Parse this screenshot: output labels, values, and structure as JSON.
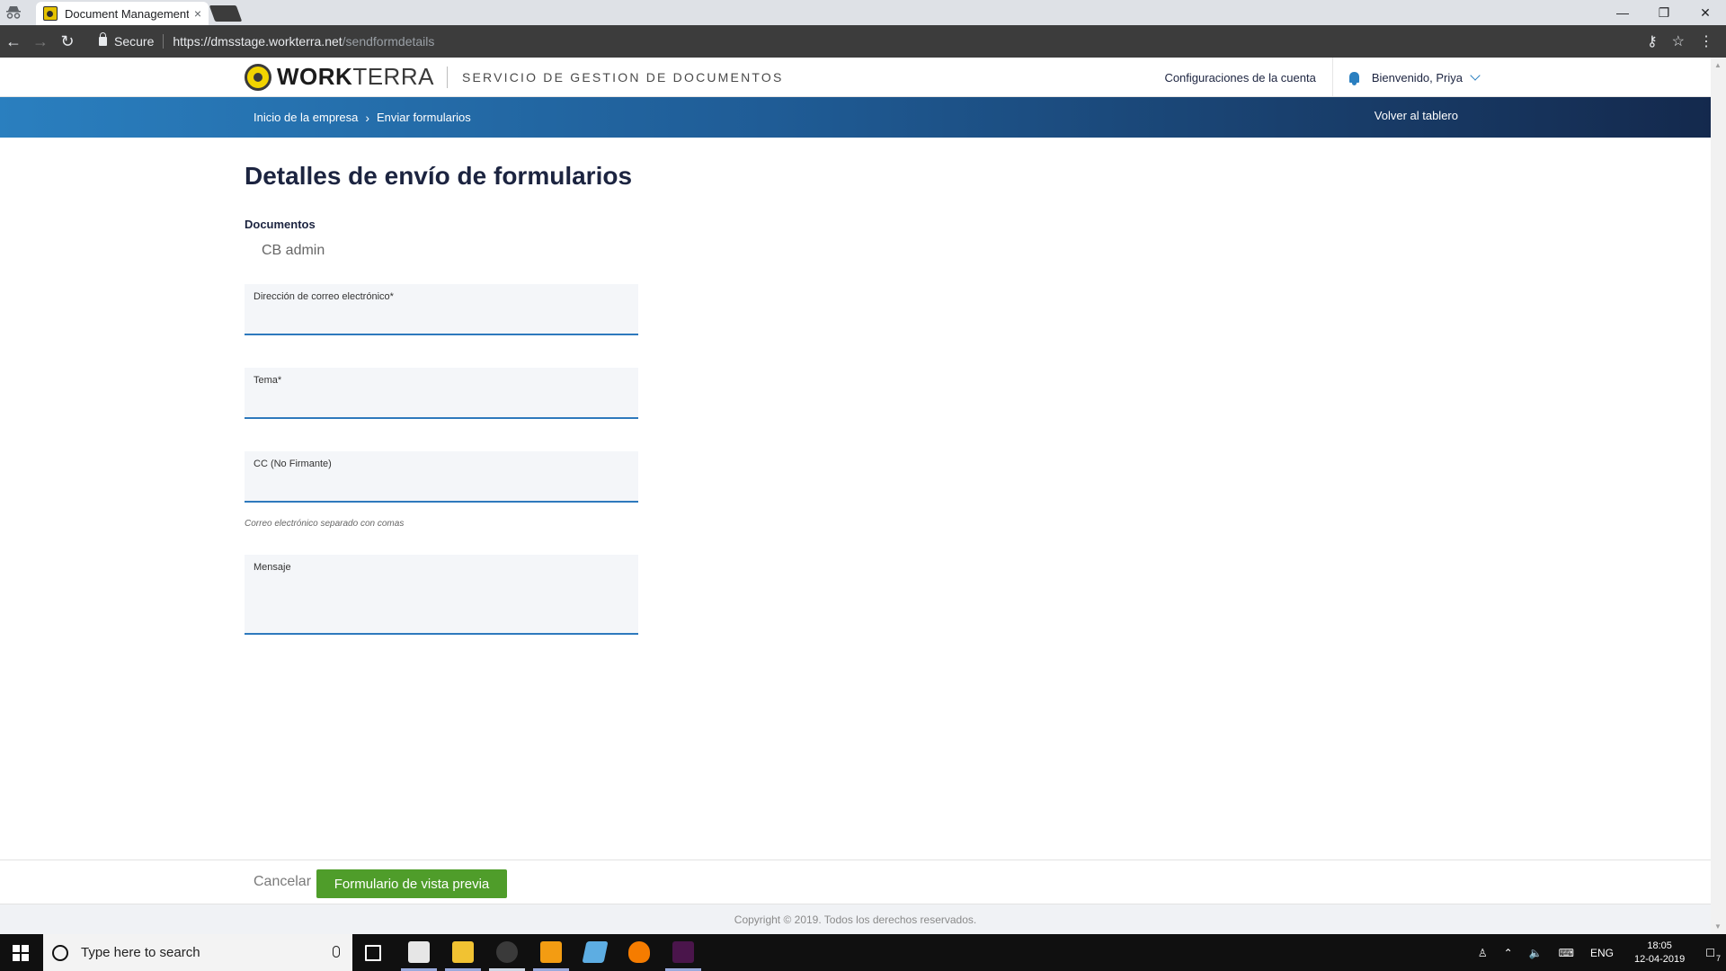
{
  "browser": {
    "tab_title": "Document Management",
    "tab_close": "×",
    "secure_label": "Secure",
    "url_host": "https://dmsstage.workterra.net",
    "url_path": "/sendformdetails"
  },
  "header": {
    "logo_work": "WORK",
    "logo_terra": "TERRA",
    "service_title": "SERVICIO DE GESTION DE DOCUMENTOS",
    "account_settings": "Configuraciones de la cuenta",
    "welcome": "Bienvenido, Priya"
  },
  "nav": {
    "breadcrumb": [
      "Inicio de la empresa",
      "Enviar formularios"
    ],
    "back_to_dashboard": "Volver al tablero"
  },
  "main": {
    "title": "Detalles de envío de formularios",
    "documents_label": "Documentos",
    "documents": [
      "CB admin"
    ],
    "fields": {
      "email_label": "Dirección de correo electrónico*",
      "subject_label": "Tema*",
      "cc_label": "CC (No Firmante)",
      "cc_helper": "Correo electrónico separado con comas",
      "message_label": "Mensaje"
    }
  },
  "footer": {
    "cancel": "Cancelar",
    "preview": "Formulario de vista previa",
    "copyright": "Copyright © 2019. Todos los derechos reservados."
  },
  "taskbar": {
    "search_placeholder": "Type here to search",
    "language": "ENG",
    "time": "18:05",
    "date": "12-04-2019",
    "notification_count": "7"
  },
  "colors": {
    "accent_blue": "#2e79bd",
    "button_green": "#4f9d2a",
    "title_navy": "#1c2440"
  }
}
